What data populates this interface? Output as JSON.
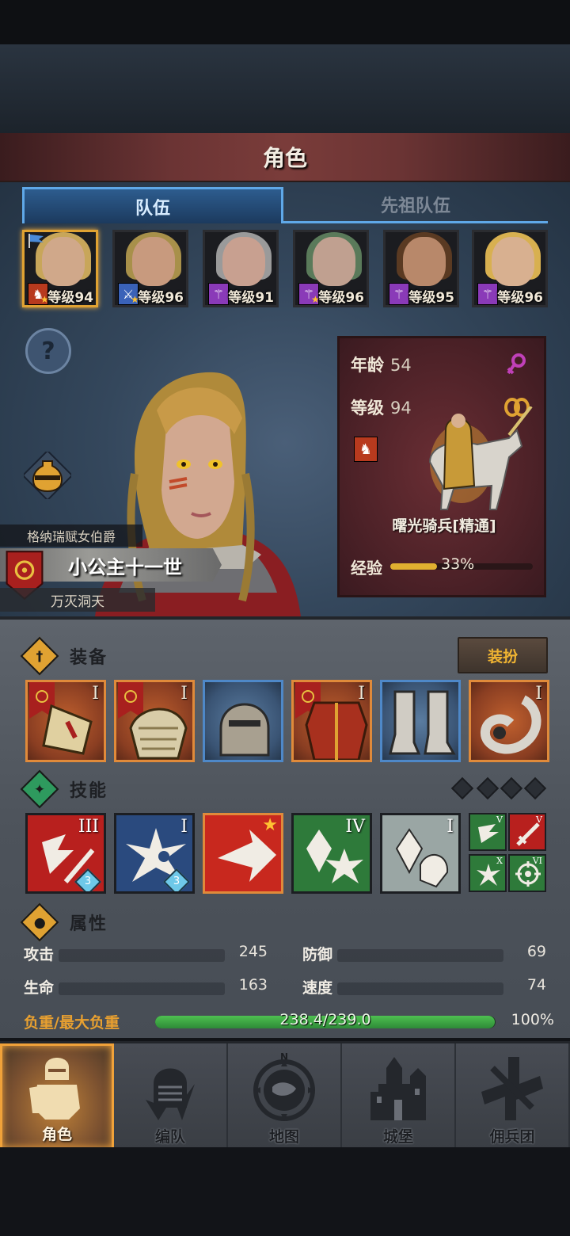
{
  "header": {
    "title": "角色"
  },
  "tabs": [
    {
      "label": "队伍",
      "active": true
    },
    {
      "label": "先祖队伍",
      "active": false
    }
  ],
  "party": [
    {
      "level_text": "等级94",
      "role_icon": "horse-icon",
      "role_color": "#b83a1e",
      "hair": "#c8a65a",
      "skin": "#d0a88a",
      "selected": true,
      "flag": true
    },
    {
      "level_text": "等级96",
      "role_icon": "sword-icon",
      "role_color": "#3a62b8",
      "hair": "#a8904a",
      "skin": "#c89a7e",
      "selected": false,
      "flag": false
    },
    {
      "level_text": "等级91",
      "role_icon": "staff-icon",
      "role_color": "#8a3ab8",
      "hair": "#9a9a9a",
      "skin": "#c8a090",
      "selected": false,
      "flag": false
    },
    {
      "level_text": "等级96",
      "role_icon": "staff-icon",
      "role_color": "#8a3ab8",
      "hair": "#5a7a5a",
      "skin": "#c0a090",
      "selected": false,
      "flag": false
    },
    {
      "level_text": "等级95",
      "role_icon": "staff-icon",
      "role_color": "#8a3ab8",
      "hair": "#5a3a22",
      "skin": "#b8886a",
      "selected": false,
      "flag": false
    },
    {
      "level_text": "等级96",
      "role_icon": "staff-icon",
      "role_color": "#8a3ab8",
      "hair": "#d8b050",
      "skin": "#d8b090",
      "selected": false,
      "flag": false
    }
  ],
  "character": {
    "title": "格纳瑞赋女伯爵",
    "name": "小公主十一世",
    "subtitle": "万灭洞天"
  },
  "info_card": {
    "age_label": "年龄",
    "age_value": "54",
    "level_label": "等级",
    "level_value": "94",
    "unit_name": "曙光骑兵[精通]",
    "exp_label": "经验",
    "exp_value": "33%",
    "exp_fraction": 0.33
  },
  "sections": {
    "equipment": "装备",
    "skills": "技能",
    "attributes": "属性"
  },
  "dress_button": "装扮",
  "equipment": [
    {
      "name": "shield",
      "tier": "I",
      "style": "orange",
      "banner": true
    },
    {
      "name": "pauldron",
      "tier": "I",
      "style": "orange",
      "banner": true
    },
    {
      "name": "helmet",
      "tier": "",
      "style": "blue",
      "banner": false
    },
    {
      "name": "armor",
      "tier": "I",
      "style": "orange",
      "banner": true
    },
    {
      "name": "boots",
      "tier": "",
      "style": "blue",
      "banner": false
    },
    {
      "name": "horn",
      "tier": "I",
      "style": "orange",
      "banner": false
    }
  ],
  "skills": [
    {
      "tier": "III",
      "bg": "#b8201e",
      "gem": "3"
    },
    {
      "tier": "I",
      "bg": "#2a4a7e",
      "gem": "3"
    },
    {
      "tier": "",
      "bg": "#c8281e",
      "gem": ""
    },
    {
      "tier": "IV",
      "bg": "#2e7a3a",
      "gem": ""
    },
    {
      "tier": "I",
      "bg": "#8a9a9a",
      "gem": ""
    }
  ],
  "mini_skills": [
    {
      "tier": "V",
      "bg": "#2e7a3a"
    },
    {
      "tier": "V",
      "bg": "#b8201e"
    },
    {
      "tier": "X",
      "bg": "#2e7a3a"
    },
    {
      "tier": "VI",
      "bg": "#2e7a3a"
    }
  ],
  "stats": {
    "attack_label": "攻击",
    "attack_value": "245",
    "defense_label": "防御",
    "defense_value": "69",
    "hp_label": "生命",
    "hp_value": "163",
    "speed_label": "速度",
    "speed_value": "74"
  },
  "weight": {
    "label": "负重/最大负重",
    "value": "238.4/239.0",
    "percent": "100%",
    "fraction": 0.997
  },
  "nav": [
    {
      "label": "角色",
      "icon": "knight-icon",
      "active": true
    },
    {
      "label": "编队",
      "icon": "helmet-icon",
      "active": false
    },
    {
      "label": "地图",
      "icon": "compass-map-icon",
      "active": false,
      "compass_letter": "N"
    },
    {
      "label": "城堡",
      "icon": "castle-icon",
      "active": false
    },
    {
      "label": "佣兵团",
      "icon": "mercenary-icon",
      "active": false
    }
  ],
  "colors": {
    "accent_gold": "#e0a232",
    "tab_blue": "#5fa8e8",
    "card_red": "#6a2e34",
    "weight_green": "#4ec050"
  }
}
